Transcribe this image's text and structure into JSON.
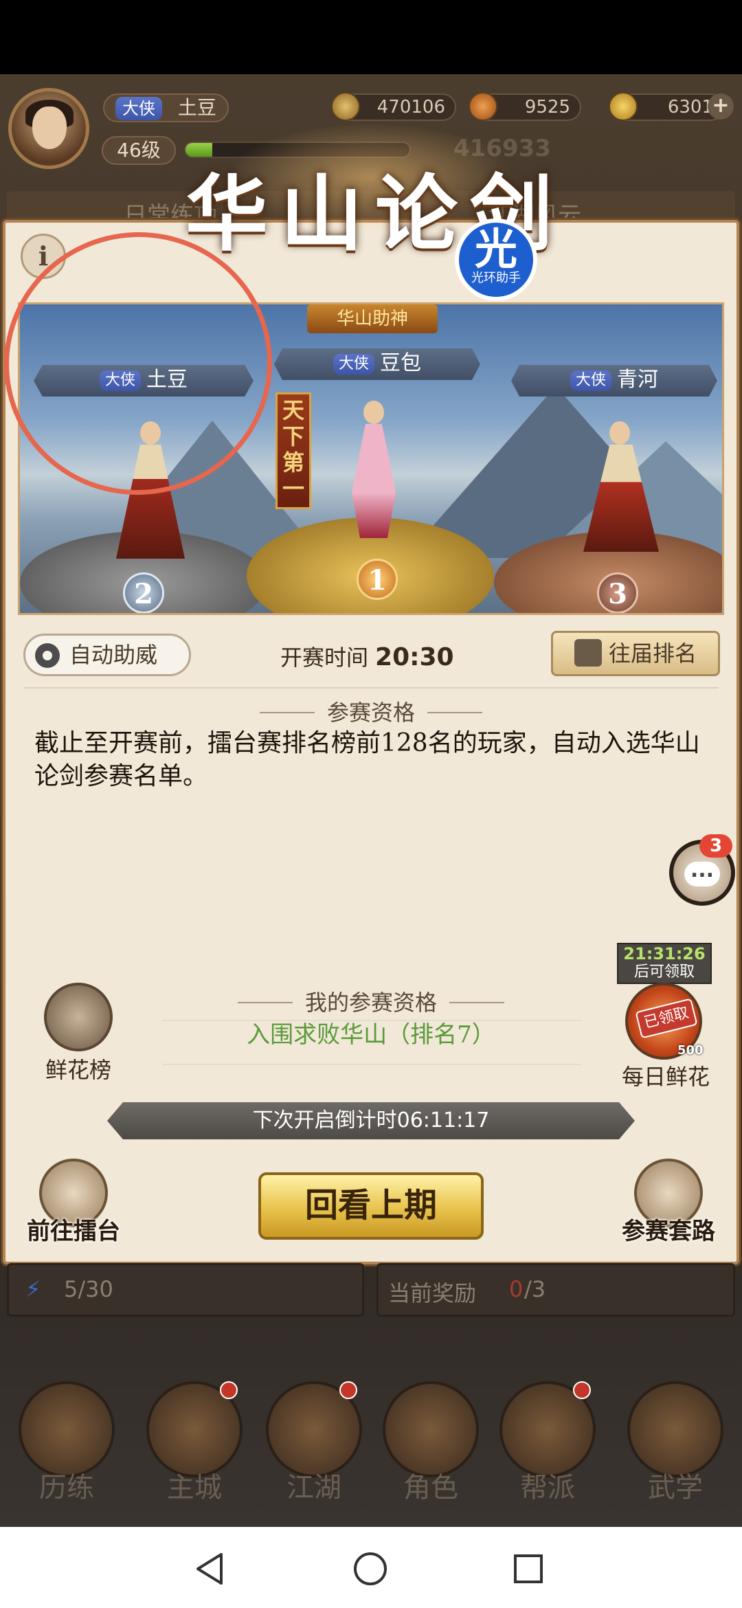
{
  "player": {
    "title_badge": "大侠",
    "name": "土豆",
    "level": "46级",
    "power": "416933"
  },
  "resources": {
    "coins": "470106",
    "flowers": "9525",
    "gold": "6301"
  },
  "dim_tabs": {
    "left": "日常练功",
    "right": "江湖风云"
  },
  "dialog": {
    "title": "华山论剑",
    "info_label": "i",
    "watermark": {
      "big": "光",
      "small": "光环助手"
    },
    "stage": {
      "top_banner": "华山助神",
      "side_banner": "天下第一",
      "contestants": [
        {
          "badge": "大侠",
          "name": "土豆",
          "rank": "2"
        },
        {
          "badge": "大侠",
          "name": "豆包",
          "rank": "1"
        },
        {
          "badge": "大侠",
          "name": "青河",
          "rank": "3"
        }
      ]
    },
    "auto_cheer": "自动助威",
    "start_time_label": "开赛时间",
    "start_time": "20:30",
    "past_rankings": "往届排名",
    "qual_section_title": "参赛资格",
    "qual_description": "截止至开赛前，擂台赛排名榜前128名的玩家，自动入选华山论剑参赛名单。",
    "chat_badge": "3",
    "chat_icon": "...",
    "my_qual_title": "我的参赛资格",
    "my_qual_value": "入围求败华山（排名7）",
    "flower_board": "鲜花榜",
    "daily_flower": {
      "timer": "21:31:26",
      "timer_sub": "后可领取",
      "stamp": "已领取",
      "count": "500",
      "label": "每日鲜花"
    },
    "countdown": "下次开启倒计时06:11:17",
    "replay_button": "回看上期",
    "go_arena": "前往擂台",
    "moves": "参赛套路"
  },
  "lower": {
    "stamina": "5/30",
    "reward_label": "当前奖励",
    "reward_value": "0",
    "reward_total": "/3"
  },
  "bottom_nav": [
    "历练",
    "主城",
    "江湖",
    "角色",
    "帮派",
    "武学"
  ],
  "colors": {
    "dialog_bg": "#f1e8d8",
    "accent_green": "#5a9a3a",
    "annotation_red": "#e6664e",
    "watermark_blue": "#1e5fd0"
  }
}
